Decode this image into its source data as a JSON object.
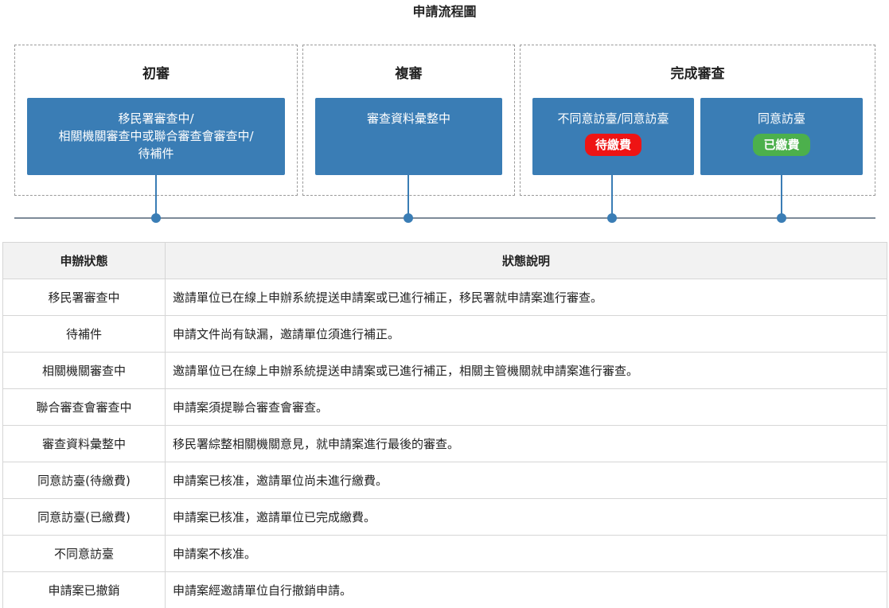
{
  "title": "申請流程圖",
  "stages": {
    "first": {
      "title": "初審",
      "box_lines": [
        "移民署審查中/",
        "相關機關審查中或聯合審查會審查中/",
        "待補件"
      ]
    },
    "second": {
      "title": "複審",
      "box_lines": [
        "審查資料彙整中"
      ]
    },
    "complete": {
      "title": "完成審查",
      "boxes": [
        {
          "label": "不同意訪臺/同意訪臺",
          "badge": "待繳費",
          "badge_color": "#ee1414"
        },
        {
          "label": "同意訪臺",
          "badge": "已繳費",
          "badge_color": "#4cb04c"
        }
      ]
    }
  },
  "colors": {
    "box": "#3a7db5",
    "timeline": "#7d8b98"
  },
  "table": {
    "headers": [
      "申辦狀態",
      "狀態說明"
    ],
    "rows": [
      {
        "status": "移民署審查中",
        "desc": "邀請單位已在線上申辦系統提送申請案或已進行補正，移民署就申請案進行審查。"
      },
      {
        "status": "待補件",
        "desc": "申請文件尚有缺漏，邀請單位須進行補正。"
      },
      {
        "status": "相關機關審查中",
        "desc": "邀請單位已在線上申辦系統提送申請案或已進行補正，相關主管機關就申請案進行審查。"
      },
      {
        "status": "聯合審查會審查中",
        "desc": "申請案須提聯合審查會審查。"
      },
      {
        "status": "審查資料彙整中",
        "desc": "移民署綜整相關機關意見，就申請案進行最後的審查。"
      },
      {
        "status": "同意訪臺(待繳費)",
        "desc": "申請案已核准，邀請單位尚未進行繳費。"
      },
      {
        "status": "同意訪臺(已繳費)",
        "desc": "申請案已核准，邀請單位已完成繳費。"
      },
      {
        "status": "不同意訪臺",
        "desc": "申請案不核准。"
      },
      {
        "status": "申請案已撤銷",
        "desc": "申請案經邀請單位自行撤銷申請。"
      }
    ]
  }
}
